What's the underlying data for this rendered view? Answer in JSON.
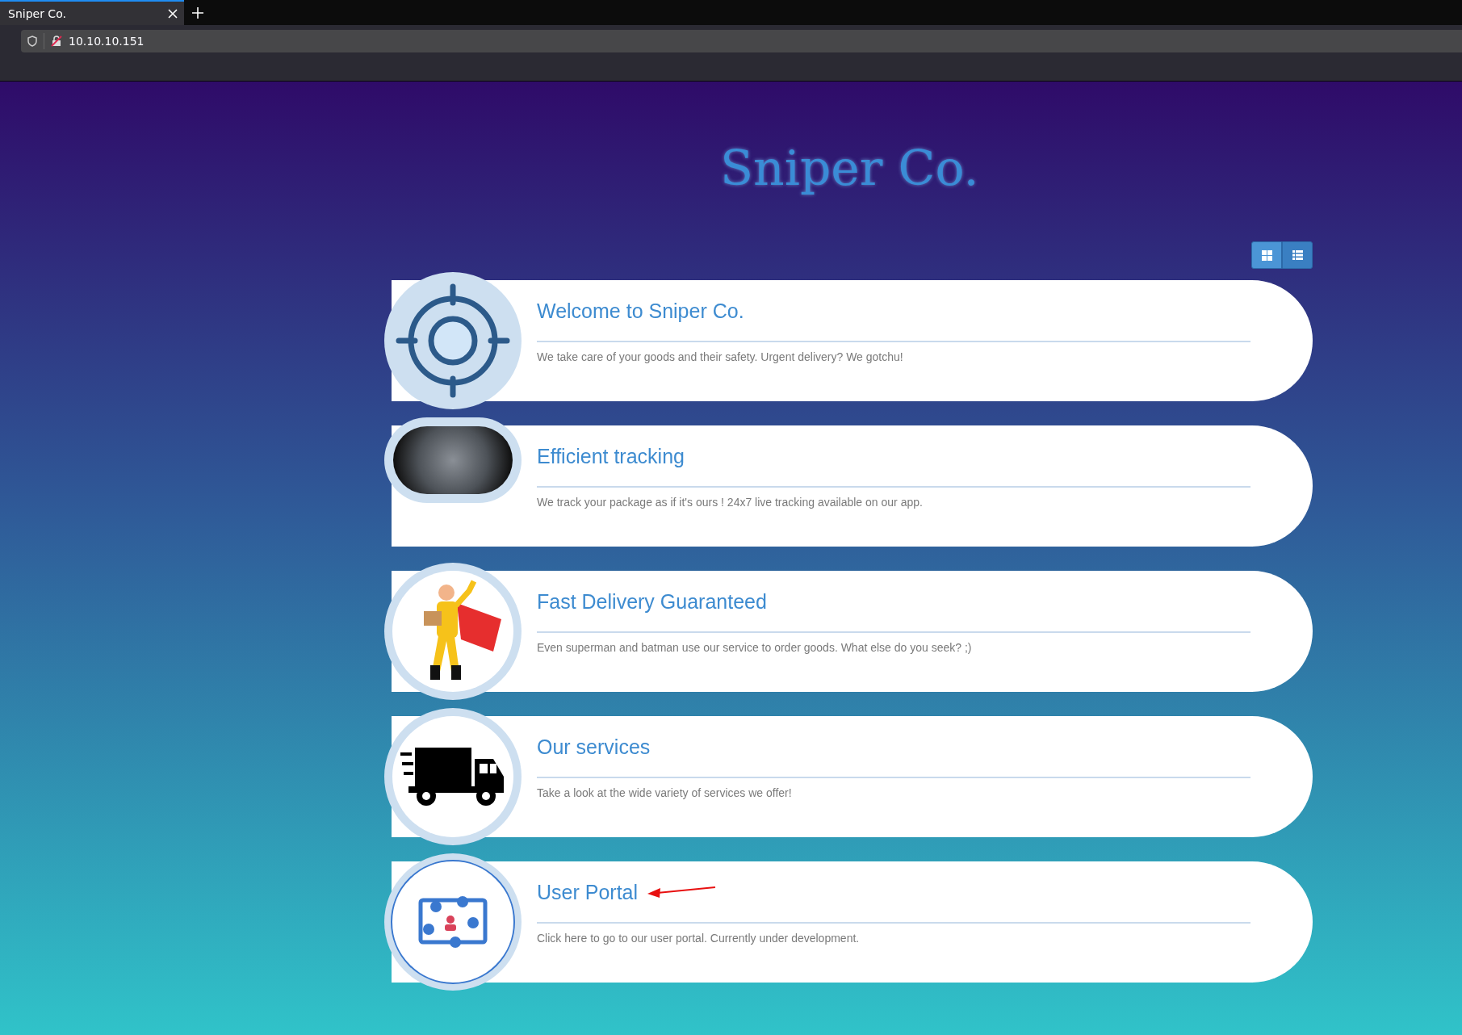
{
  "browser": {
    "tab_title": "Sniper Co.",
    "url": "10.10.10.151"
  },
  "site_title": "Sniper Co.",
  "view_toggle": [
    {
      "kind": "grid",
      "selected": true
    },
    {
      "kind": "list",
      "selected": false
    }
  ],
  "cards": [
    {
      "kind": "target",
      "title": "Welcome to Sniper Co.",
      "text": "We take care of your goods and their safety. Urgent delivery? We gotchu!",
      "pointer_arrow": false
    },
    {
      "kind": "photo",
      "title": "Efficient tracking",
      "text": "We track your package as if it's ours ! 24x7 live tracking available on our app.",
      "pointer_arrow": false
    },
    {
      "kind": "hero",
      "title": "Fast Delivery Guaranteed",
      "text": "Even superman and batman use our service to order goods. What else do you seek? ;)",
      "pointer_arrow": false
    },
    {
      "kind": "truck",
      "title": "Our services",
      "text": "Take a look at the wide variety of services we offer!",
      "pointer_arrow": false
    },
    {
      "kind": "portal",
      "title": "User Portal",
      "text": "Click here to go to our user portal. Currently under development.",
      "pointer_arrow": true
    }
  ]
}
